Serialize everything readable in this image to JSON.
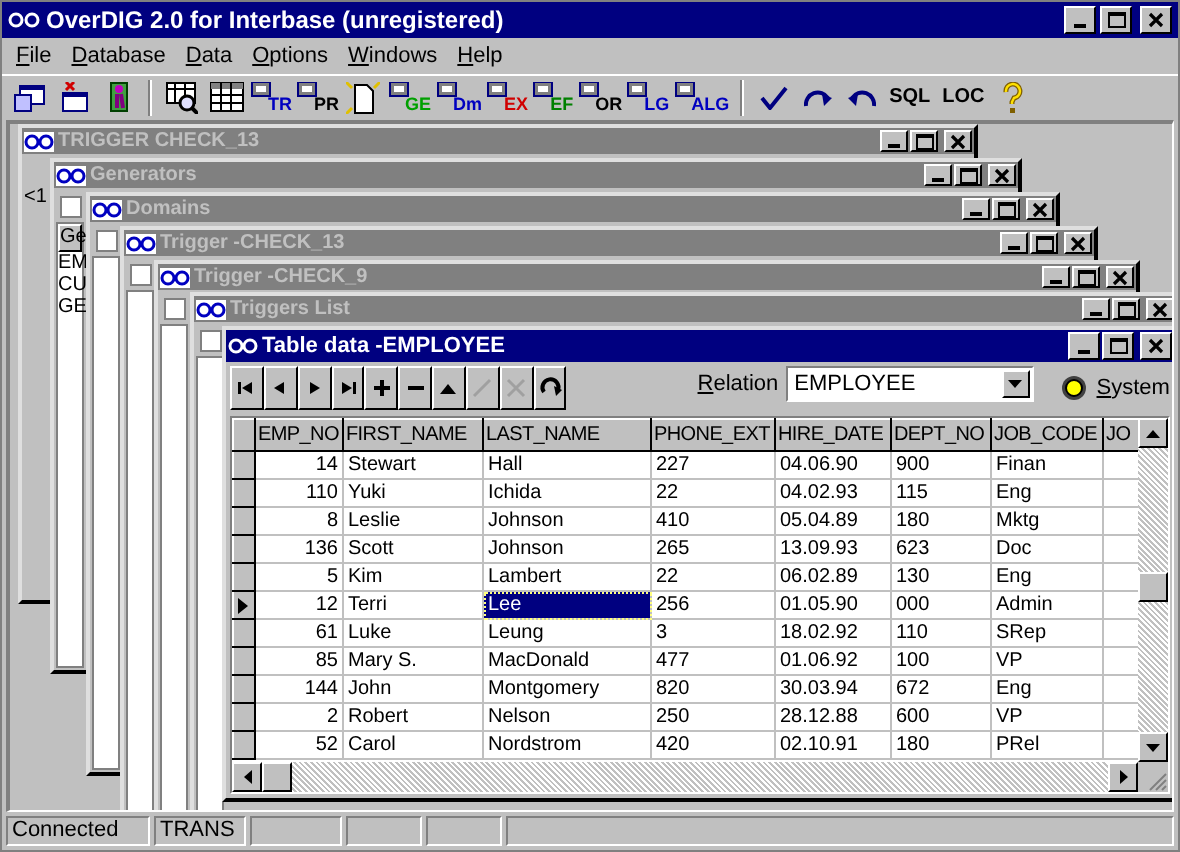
{
  "window": {
    "title": "OverDIG 2.0  for Interbase (unregistered)"
  },
  "menu": [
    {
      "label": "File",
      "mnemonic": true
    },
    {
      "label": "Database",
      "mnemonic": true
    },
    {
      "label": "Data",
      "mnemonic": true
    },
    {
      "label": "Options",
      "mnemonic": true
    },
    {
      "label": "Windows",
      "mnemonic": true
    },
    {
      "label": "Help",
      "mnemonic": true
    }
  ],
  "toolbar": [
    [
      {
        "kind": "connect"
      },
      {
        "kind": "disconnect"
      },
      {
        "kind": "exit"
      }
    ],
    [
      {
        "kind": "browse"
      },
      {
        "kind": "grid"
      },
      {
        "kind": "tagged",
        "label": "TR",
        "color": "#0000c0"
      },
      {
        "kind": "tagged",
        "label": "PR",
        "color": "#000000"
      },
      {
        "kind": "new"
      },
      {
        "kind": "tagged",
        "label": "GE",
        "color": "#00a000"
      },
      {
        "kind": "tagged",
        "label": "Dm",
        "color": "#0000c0"
      },
      {
        "kind": "tagged",
        "label": "EX",
        "color": "#d00000"
      },
      {
        "kind": "tagged",
        "label": "EF",
        "color": "#008000"
      },
      {
        "kind": "tagged",
        "label": "OR",
        "color": "#000000"
      },
      {
        "kind": "tagged",
        "label": "LG",
        "color": "#0000c0"
      },
      {
        "kind": "tagged",
        "label": "ALG",
        "color": "#0000c0"
      }
    ],
    [
      {
        "kind": "check"
      },
      {
        "kind": "undo"
      },
      {
        "kind": "redo"
      },
      {
        "kind": "text",
        "label": "SQL"
      },
      {
        "kind": "text",
        "label": "LOC"
      },
      {
        "kind": "help"
      }
    ]
  ],
  "mdi_windows": [
    {
      "title": "TRIGGER CHECK_13",
      "active": false,
      "snippets": [
        "<1"
      ]
    },
    {
      "title": "Generators",
      "active": false,
      "checked": false,
      "header": "Ge",
      "items": [
        "EM",
        "CU",
        "GE"
      ]
    },
    {
      "title": "Domains",
      "active": false,
      "checked": false
    },
    {
      "title": "Trigger -CHECK_13",
      "active": false,
      "checked": false
    },
    {
      "title": "Trigger -CHECK_9",
      "active": false,
      "checked": false
    },
    {
      "title": "Triggers List",
      "active": false,
      "checked": false
    },
    {
      "title": "Table data -EMPLOYEE",
      "active": true
    }
  ],
  "table_window": {
    "relation_label": "Relation",
    "relation": "EMPLOYEE",
    "system": {
      "label": "System",
      "selected": true
    },
    "nav_buttons": [
      {
        "kind": "first",
        "disabled": false
      },
      {
        "kind": "prior",
        "disabled": false
      },
      {
        "kind": "next",
        "disabled": false
      },
      {
        "kind": "last",
        "disabled": false
      },
      {
        "kind": "insert",
        "disabled": false
      },
      {
        "kind": "delete",
        "disabled": false
      },
      {
        "kind": "edit",
        "disabled": false
      },
      {
        "kind": "post",
        "disabled": true
      },
      {
        "kind": "cancel",
        "disabled": true
      },
      {
        "kind": "refresh",
        "disabled": false
      }
    ],
    "columns": [
      "EMP_NO",
      "FIRST_NAME",
      "LAST_NAME",
      "PHONE_EXT",
      "HIRE_DATE",
      "DEPT_NO",
      "JOB_CODE",
      "JO"
    ],
    "rows": [
      {
        "cells": [
          "14",
          "Stewart",
          "Hall",
          "227",
          "04.06.90",
          "900",
          "Finan"
        ],
        "selected": false
      },
      {
        "cells": [
          "110",
          "Yuki",
          "Ichida",
          "22",
          "04.02.93",
          "115",
          "Eng"
        ],
        "selected": false
      },
      {
        "cells": [
          "8",
          "Leslie",
          "Johnson",
          "410",
          "05.04.89",
          "180",
          "Mktg"
        ],
        "selected": false
      },
      {
        "cells": [
          "136",
          "Scott",
          "Johnson",
          "265",
          "13.09.93",
          "623",
          "Doc"
        ],
        "selected": false
      },
      {
        "cells": [
          "5",
          "Kim",
          "Lambert",
          "22",
          "06.02.89",
          "130",
          "Eng"
        ],
        "selected": false
      },
      {
        "cells": [
          "12",
          "Terri",
          "Lee",
          "256",
          "01.05.90",
          "000",
          "Admin"
        ],
        "selected": true
      },
      {
        "cells": [
          "61",
          "Luke",
          "Leung",
          "3",
          "18.02.92",
          "110",
          "SRep"
        ],
        "selected": false
      },
      {
        "cells": [
          "85",
          "Mary S.",
          "MacDonald",
          "477",
          "01.06.92",
          "100",
          "VP"
        ],
        "selected": false
      },
      {
        "cells": [
          "144",
          "John",
          "Montgomery",
          "820",
          "30.03.94",
          "672",
          "Eng"
        ],
        "selected": false
      },
      {
        "cells": [
          "2",
          "Robert",
          "Nelson",
          "250",
          "28.12.88",
          "600",
          "VP"
        ],
        "selected": false
      },
      {
        "cells": [
          "52",
          "Carol",
          "Nordstrom",
          "420",
          "02.10.91",
          "180",
          "PRel"
        ],
        "selected": false
      }
    ]
  },
  "status_bar": [
    "Connected",
    "TRANS"
  ]
}
